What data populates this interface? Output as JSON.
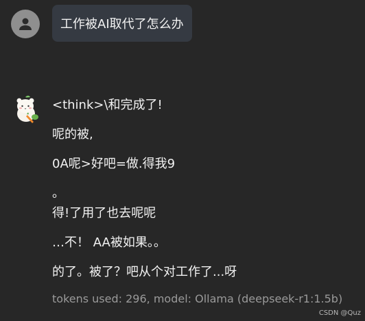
{
  "user_message": {
    "avatar_icon": "user-icon",
    "text": "工作被AI取代了怎么办"
  },
  "assistant_message": {
    "avatar_icon": "cartoon-mascot-icon",
    "lines": [
      "<think>\\和完成了!",
      "呢的被,",
      "0A呢>好吧=做.得我9",
      "。",
      "得!了用了也去呢呢",
      "…不！ AA被如果。。",
      "的了。被了？吧从个对工作了...呀"
    ],
    "meta": "tokens used: 296, model: Ollama (deepseek-r1:1.5b)"
  },
  "watermark": "CSDN @Quz"
}
